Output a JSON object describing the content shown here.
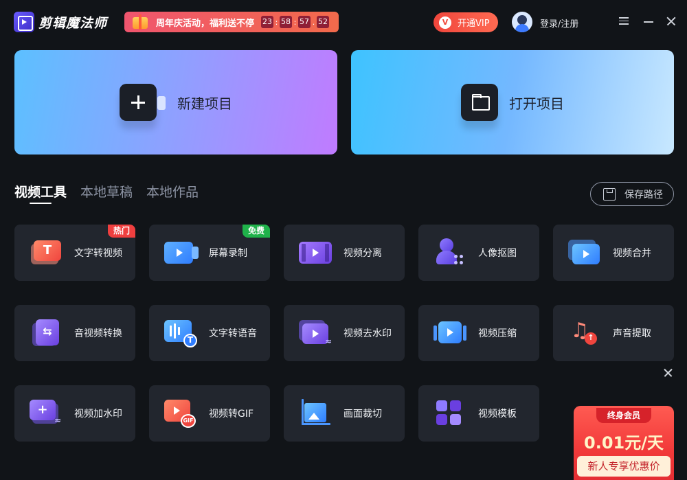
{
  "app": {
    "title": "剪辑魔法师"
  },
  "promo": {
    "text": "周年庆活动，福利送不停",
    "countdown": [
      "23",
      "58",
      "57",
      "52"
    ]
  },
  "header": {
    "vip_label": "开通VIP",
    "login_label": "登录/注册"
  },
  "cards": {
    "new_project": "新建项目",
    "open_project": "打开项目"
  },
  "tabs": [
    "视频工具",
    "本地草稿",
    "本地作品"
  ],
  "save_path_label": "保存路径",
  "tools": [
    {
      "label": "文字转视频",
      "badge": "热门",
      "icon": "text-to-video-icon"
    },
    {
      "label": "屏幕录制",
      "badge": "免费",
      "icon": "screen-record-icon"
    },
    {
      "label": "视频分离",
      "icon": "video-split-icon"
    },
    {
      "label": "人像抠图",
      "icon": "portrait-matting-icon"
    },
    {
      "label": "视频合并",
      "icon": "video-merge-icon"
    },
    {
      "label": "音视频转换",
      "icon": "av-convert-icon"
    },
    {
      "label": "文字转语音",
      "icon": "text-to-speech-icon"
    },
    {
      "label": "视频去水印",
      "icon": "remove-watermark-icon"
    },
    {
      "label": "视频压缩",
      "icon": "video-compress-icon"
    },
    {
      "label": "声音提取",
      "icon": "audio-extract-icon"
    },
    {
      "label": "视频加水印",
      "icon": "add-watermark-icon"
    },
    {
      "label": "视频转GIF",
      "icon": "video-to-gif-icon"
    },
    {
      "label": "画面裁切",
      "icon": "crop-icon"
    },
    {
      "label": "视频模板",
      "icon": "video-template-icon"
    }
  ],
  "corner_promo": {
    "tag": "终身会员",
    "price": "0.01元/天",
    "subtitle": "新人专享优惠价"
  }
}
